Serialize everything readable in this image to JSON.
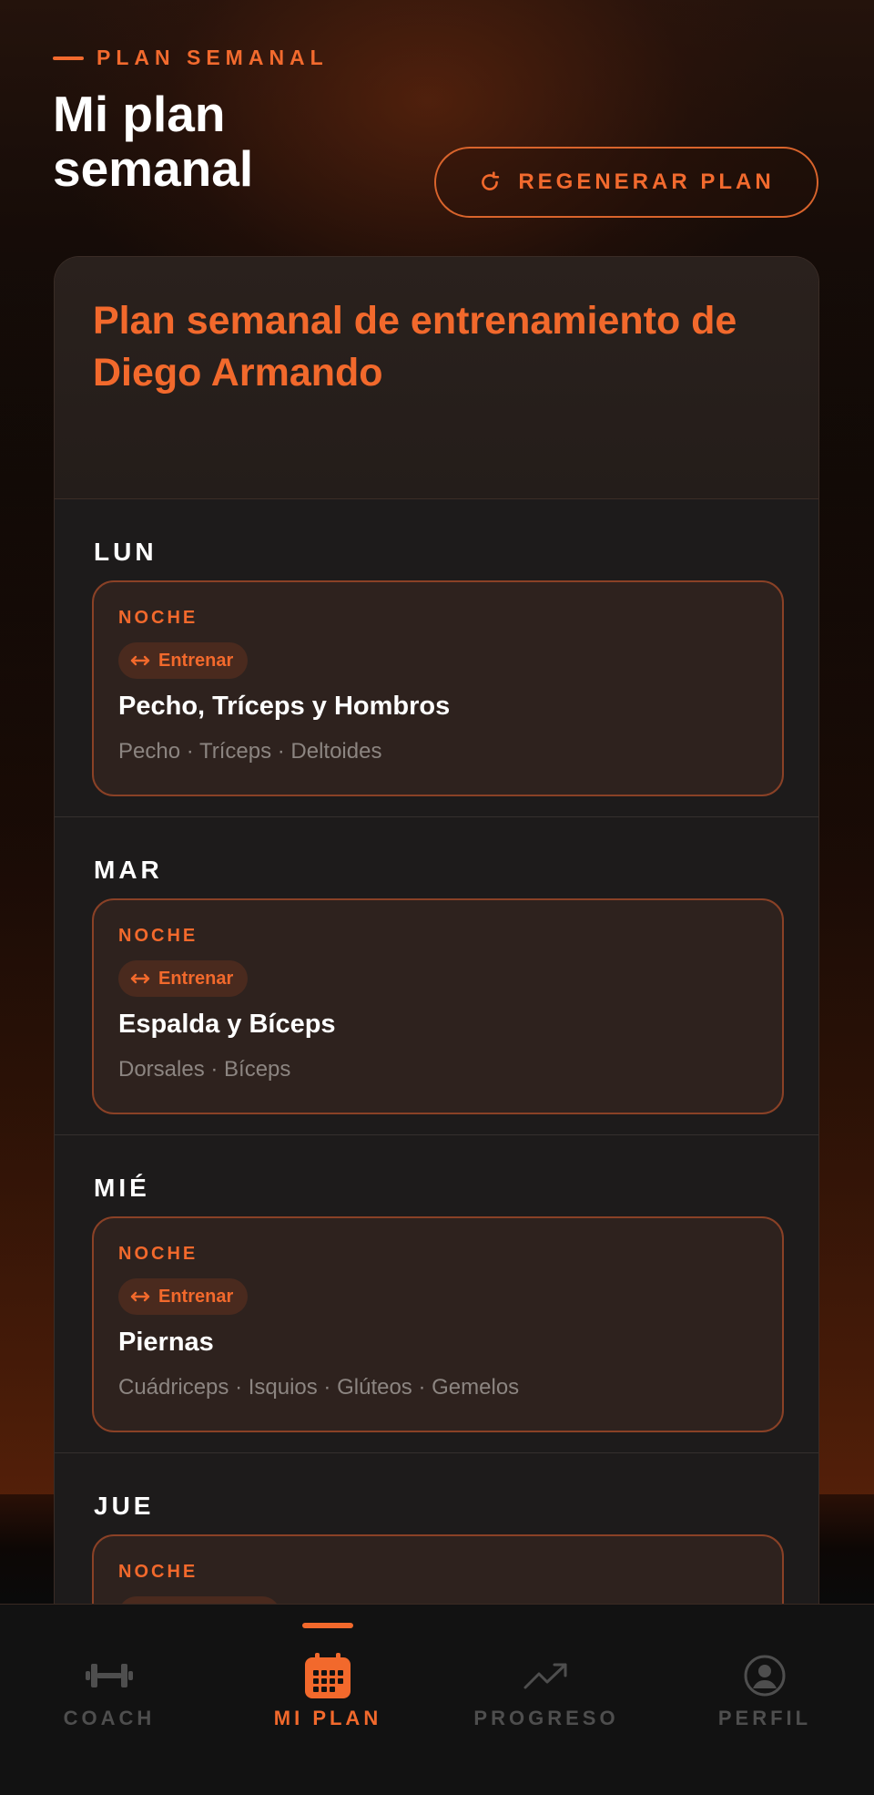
{
  "header": {
    "kicker": "PLAN SEMANAL",
    "title": "Mi plan semanal",
    "regenerate_label": "REGENERAR PLAN"
  },
  "plan": {
    "title": "Plan semanal de entrenamiento de Diego Armando",
    "days": [
      {
        "day": "LUN",
        "session": {
          "time": "NOCHE",
          "type": "Entrenar",
          "name": "Pecho, Tríceps y Hombros",
          "muscles": "Pecho · Tríceps · Deltoides"
        }
      },
      {
        "day": "MAR",
        "session": {
          "time": "NOCHE",
          "type": "Entrenar",
          "name": "Espalda y Bíceps",
          "muscles": "Dorsales · Bíceps"
        }
      },
      {
        "day": "MIÉ",
        "session": {
          "time": "NOCHE",
          "type": "Entrenar",
          "name": "Piernas",
          "muscles": "Cuádriceps · Isquios · Glúteos · Gemelos"
        }
      },
      {
        "day": "JUE",
        "session": {
          "time": "NOCHE"
        }
      }
    ]
  },
  "tabs": [
    {
      "label": "COACH",
      "icon": "dumbbell-icon",
      "active": false
    },
    {
      "label": "MI PLAN",
      "icon": "calendar-icon",
      "active": true
    },
    {
      "label": "PROGRESO",
      "icon": "trend-up-icon",
      "active": false
    },
    {
      "label": "PERFIL",
      "icon": "user-circle-icon",
      "active": false
    }
  ],
  "colors": {
    "accent": "#f2692c",
    "background": "#0a0a0a",
    "card": "#1d1b1b",
    "session_border": "#8a4126",
    "inactive": "#4e4e4e"
  }
}
